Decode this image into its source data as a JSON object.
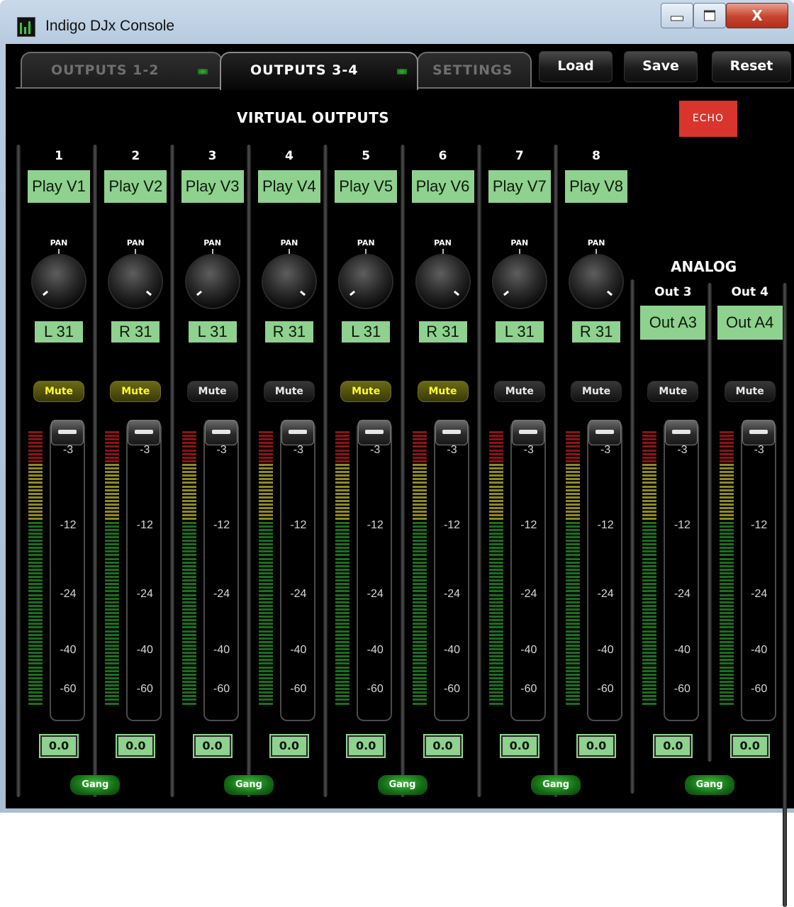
{
  "window": {
    "title": "Indigo DJx Console",
    "close_glyph": "X"
  },
  "tabs": [
    {
      "label": "OUTPUTS 1-2",
      "active": false
    },
    {
      "label": "OUTPUTS 3-4",
      "active": true
    },
    {
      "label": "SETTINGS",
      "active": false
    }
  ],
  "toolbar": {
    "load": "Load",
    "save": "Save",
    "reset": "Reset"
  },
  "virtual_outputs": {
    "title": "VIRTUAL OUTPUTS",
    "echo_label": "ECHO",
    "pan_label": "PAN",
    "channels": [
      {
        "num": "1",
        "name": "Play V1",
        "pan": "L 31",
        "mute": "Mute",
        "mute_on": true,
        "level": "0.0"
      },
      {
        "num": "2",
        "name": "Play V2",
        "pan": "R 31",
        "mute": "Mute",
        "mute_on": true,
        "level": "0.0"
      },
      {
        "num": "3",
        "name": "Play V3",
        "pan": "L 31",
        "mute": "Mute",
        "mute_on": false,
        "level": "0.0"
      },
      {
        "num": "4",
        "name": "Play V4",
        "pan": "R 31",
        "mute": "Mute",
        "mute_on": false,
        "level": "0.0"
      },
      {
        "num": "5",
        "name": "Play V5",
        "pan": "L 31",
        "mute": "Mute",
        "mute_on": true,
        "level": "0.0"
      },
      {
        "num": "6",
        "name": "Play V6",
        "pan": "R 31",
        "mute": "Mute",
        "mute_on": true,
        "level": "0.0"
      },
      {
        "num": "7",
        "name": "Play V7",
        "pan": "L 31",
        "mute": "Mute",
        "mute_on": false,
        "level": "0.0"
      },
      {
        "num": "8",
        "name": "Play V8",
        "pan": "R 31",
        "mute": "Mute",
        "mute_on": false,
        "level": "0.0"
      }
    ]
  },
  "analog": {
    "title": "ANALOG",
    "outputs": [
      {
        "label": "Out 3",
        "name": "Out A3",
        "mute": "Mute",
        "mute_on": false,
        "level": "0.0"
      },
      {
        "label": "Out 4",
        "name": "Out A4",
        "mute": "Mute",
        "mute_on": false,
        "level": "0.0"
      }
    ]
  },
  "fader_scale": [
    "-3",
    "-12",
    "-24",
    "-40",
    "-60"
  ],
  "gang_label": "Gang",
  "colors": {
    "lcd_green": "#8fd18f",
    "mute_active_yellow": "#fffa2a",
    "echo_red": "#d9352c",
    "meter_red": "#8a1414",
    "meter_yellow": "#8f8a22",
    "meter_green": "#1d6e1d"
  }
}
